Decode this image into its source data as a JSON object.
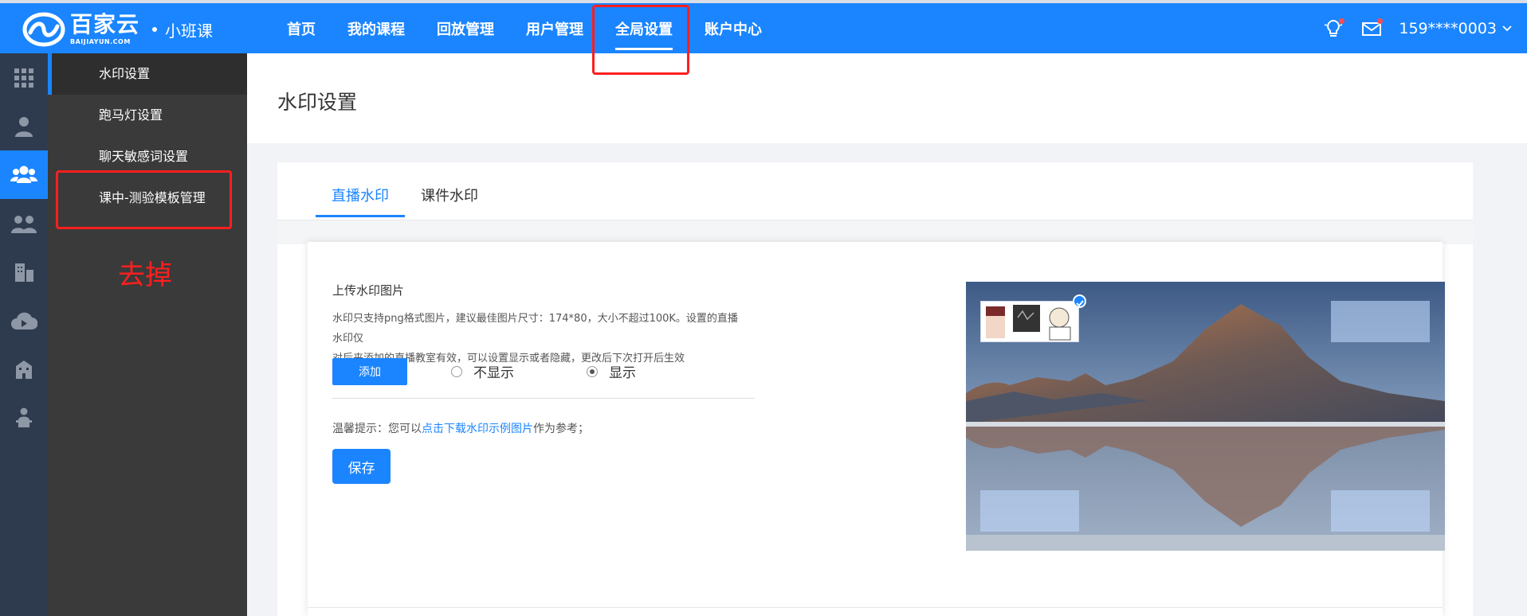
{
  "header": {
    "logo_cn": "百家云",
    "logo_en": "BAIJIAYUN.COM",
    "product": "小班课",
    "nav": [
      "首页",
      "我的课程",
      "回放管理",
      "用户管理",
      "全局设置",
      "账户中心"
    ],
    "active_nav_index": 4,
    "user": "159****0003",
    "icons": [
      "lightbulb-icon",
      "mail-icon",
      "chevron-down-icon"
    ]
  },
  "rail": {
    "icons": [
      "grid-icon",
      "teacher-icon",
      "users-icon",
      "group-icon",
      "building-icon",
      "cloud-play-icon",
      "office-icon",
      "lecturer-icon"
    ],
    "active_index": 2
  },
  "submenu": {
    "items": [
      "水印设置",
      "跑马灯设置",
      "聊天敏感词设置",
      "课中-测验模板管理"
    ],
    "active_index": 0
  },
  "annotation": {
    "remove_label": "去掉",
    "color": "#ff1f1f"
  },
  "page": {
    "title": "水印设置"
  },
  "tabs": [
    "直播水印",
    "课件水印"
  ],
  "watermark": {
    "upload_title": "上传水印图片",
    "desc_line1": "水印只支持png格式图片，建议最佳图片尺寸：174*80，大小不超过100K。设置的直播水印仅",
    "desc_line2": "对后来添加的直播教室有效，可以设置显示或者隐藏，更改后下次打开后生效",
    "add_button": "添加",
    "radio_hide": "不显示",
    "radio_show": "显示",
    "selected_radio": "显示",
    "tip_prefix": "温馨提示：您可以",
    "tip_link": "点击下载水印示例图片",
    "tip_suffix": "作为参考；",
    "save_button": "保存"
  },
  "colors": {
    "brand": "#1a85ff",
    "rail_bg": "#2e3b4e",
    "submenu_bg": "#3a3a3a"
  }
}
